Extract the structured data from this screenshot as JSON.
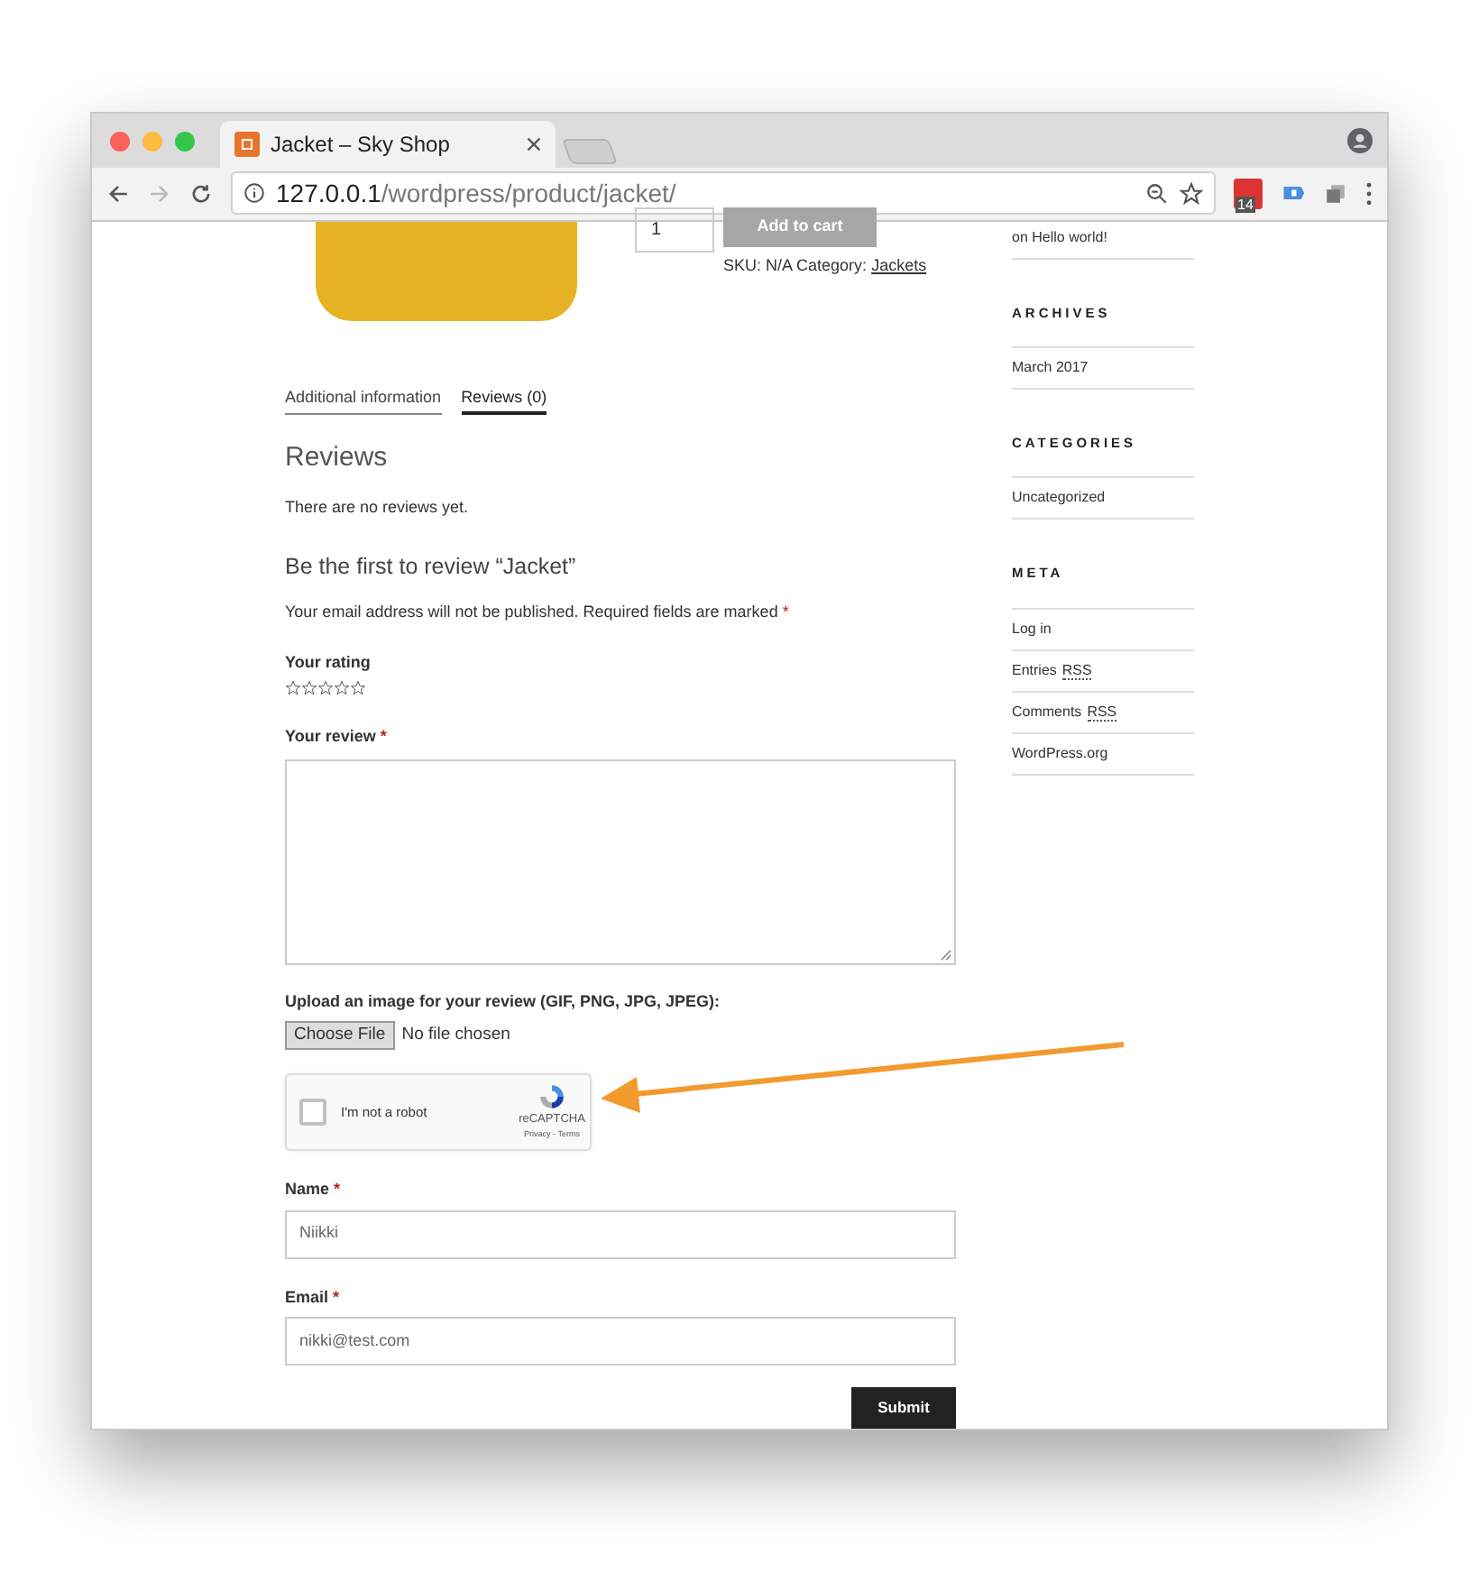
{
  "tab": {
    "title": "Jacket – Sky Shop"
  },
  "address": {
    "host": "127.0.0.1",
    "path": "/wordpress/product/jacket/"
  },
  "extension_badge": "14",
  "product": {
    "quantity": "1",
    "add_to_cart": "Add to cart",
    "sku_label": "SKU: N/A Category:",
    "category": "Jackets"
  },
  "tabs": [
    {
      "label": "Additional information",
      "selected": false
    },
    {
      "label": "Reviews (0)",
      "selected": true
    }
  ],
  "reviews": {
    "title": "Reviews",
    "empty": "There are no reviews yet."
  },
  "form": {
    "title": "Be the first to review “Jacket”",
    "note": "Your email address will not be published. Required fields are marked",
    "required_mark": "*",
    "rating_label": "Your rating",
    "stars": 0,
    "review_label": "Your review",
    "upload_label": "Upload an image for your review (GIF, PNG, JPG, JPEG):",
    "choose_file": "Choose File",
    "no_file": "No file chosen",
    "captcha": {
      "label": "I'm not a robot",
      "checked": false,
      "brand": "reCAPTCHA",
      "links": "Privacy - Terms"
    },
    "name_label": "Name",
    "name_value": "Niikki",
    "email_label": "Email",
    "email_value": "nikki@test.com",
    "submit": "Submit"
  },
  "sidebar": {
    "recent_comment": "on Hello world!",
    "sections": [
      {
        "title": "ARCHIVES",
        "items": [
          {
            "parts": [
              "March 2017"
            ]
          }
        ]
      },
      {
        "title": "CATEGORIES",
        "items": [
          {
            "parts": [
              "Uncategorized"
            ]
          }
        ]
      },
      {
        "title": "META",
        "items": [
          {
            "parts": [
              "Log in"
            ]
          },
          {
            "parts": [
              "Entries",
              "RSS"
            ]
          },
          {
            "parts": [
              "Comments",
              "RSS"
            ]
          },
          {
            "parts": [
              "WordPress.org"
            ]
          }
        ]
      }
    ]
  }
}
